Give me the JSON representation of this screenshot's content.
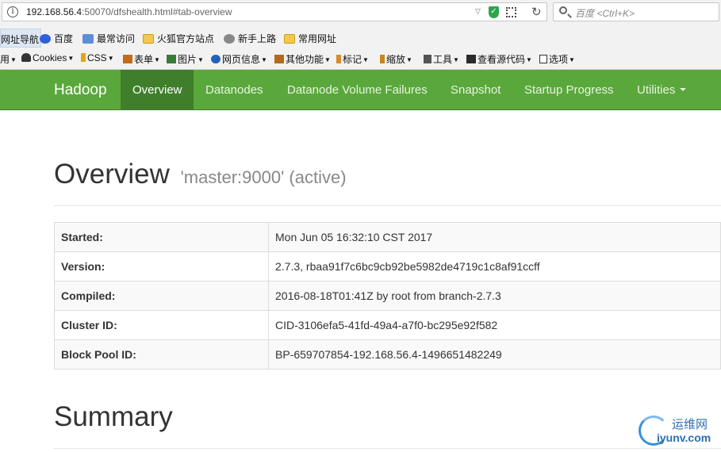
{
  "browser": {
    "url_host": "192.168.56.4",
    "url_rest": ":50070/dfshealth.html#tab-overview",
    "search_placeholder": "百度 <Ctrl+K>",
    "bookmarks": [
      "网址导航",
      "百度",
      "最常访问",
      "火狐官方站点",
      "新手上路",
      "常用网址"
    ],
    "toolbar": [
      "用",
      "Cookies",
      "CSS",
      "表单",
      "图片",
      "网页信息",
      "其他功能",
      "标记",
      "缩放",
      "工具",
      "查看源代码",
      "选项"
    ]
  },
  "navbar": {
    "brand": "Hadoop",
    "items": [
      "Overview",
      "Datanodes",
      "Datanode Volume Failures",
      "Snapshot",
      "Startup Progress",
      "Utilities"
    ],
    "active_index": 0,
    "accent_color": "#5aa83b"
  },
  "overview": {
    "title": "Overview",
    "subtitle": "'master:9000' (active)",
    "rows": [
      {
        "key": "Started:",
        "value": "Mon Jun 05 16:32:10 CST 2017"
      },
      {
        "key": "Version:",
        "value": "2.7.3, rbaa91f7c6bc9cb92be5982de4719c1c8af91ccff"
      },
      {
        "key": "Compiled:",
        "value": "2016-08-18T01:41Z by root from branch-2.7.3"
      },
      {
        "key": "Cluster ID:",
        "value": "CID-3106efa5-41fd-49a4-a7f0-bc295e92f582"
      },
      {
        "key": "Block Pool ID:",
        "value": "BP-659707854-192.168.56.4-1496651482249"
      }
    ]
  },
  "summary": {
    "title": "Summary"
  },
  "watermark": {
    "cn": "运维网",
    "en": "iyunv.com"
  }
}
